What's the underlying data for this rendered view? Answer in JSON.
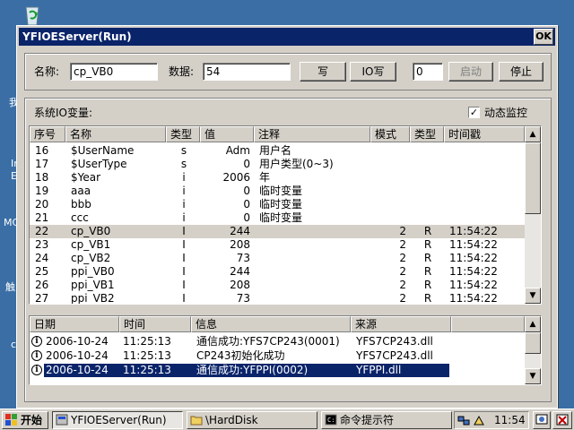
{
  "window": {
    "title": "YFIOEServer(Run)",
    "ok_label": "OK"
  },
  "controls": {
    "name_label": "名称:",
    "name_value": "cp_VB0",
    "data_label": "数据:",
    "data_value": "54",
    "write_label": "写",
    "io_write_label": "IO写",
    "counter_value": "0",
    "start_label": "启动",
    "stop_label": "停止"
  },
  "vars": {
    "section_label": "系统IO变量:",
    "monitor_label": "动态监控",
    "monitor_checked": true,
    "columns": [
      "序号",
      "名称",
      "类型",
      "值",
      "注释",
      "模式",
      "类型",
      "时间戳"
    ],
    "rows": [
      [
        "16",
        "$UserName",
        "s",
        "Adm",
        "用户名",
        "",
        "",
        ""
      ],
      [
        "17",
        "$UserType",
        "s",
        "0",
        "用户类型(0~3)",
        "",
        "",
        ""
      ],
      [
        "18",
        "$Year",
        "i",
        "2006",
        "年",
        "",
        "",
        ""
      ],
      [
        "19",
        "aaa",
        "i",
        "0",
        "临时变量",
        "",
        "",
        ""
      ],
      [
        "20",
        "bbb",
        "i",
        "0",
        "临时变量",
        "",
        "",
        ""
      ],
      [
        "21",
        "ccc",
        "i",
        "0",
        "临时变量",
        "",
        "",
        ""
      ],
      [
        "22",
        "cp_VB0",
        "I",
        "244",
        "",
        "2",
        "R",
        "11:54:22"
      ],
      [
        "23",
        "cp_VB1",
        "I",
        "208",
        "",
        "2",
        "R",
        "11:54:22"
      ],
      [
        "24",
        "cp_VB2",
        "I",
        "73",
        "",
        "2",
        "R",
        "11:54:22"
      ],
      [
        "25",
        "ppi_VB0",
        "I",
        "244",
        "",
        "2",
        "R",
        "11:54:22"
      ],
      [
        "26",
        "ppi_VB1",
        "I",
        "208",
        "",
        "2",
        "R",
        "11:54:22"
      ],
      [
        "27",
        "ppi_VB2",
        "I",
        "73",
        "",
        "2",
        "R",
        "11:54:22"
      ]
    ],
    "selected_row": 6
  },
  "log": {
    "columns": [
      "日期",
      "时间",
      "信息",
      "来源"
    ],
    "rows": [
      [
        "2006-10-24",
        "11:25:13",
        "通信成功:YFS7CP243(0001)",
        "YFS7CP243.dll"
      ],
      [
        "2006-10-24",
        "11:25:13",
        "CP243初始化成功",
        "YFS7CP243.dll"
      ],
      [
        "2006-10-24",
        "11:25:13",
        "通信成功:YFPPI(0002)",
        "YFPPI.dll"
      ]
    ],
    "selected_row": 2
  },
  "taskbar": {
    "start_label": "开始",
    "tasks": [
      "YFIOEServer(Run)",
      "\\HardDisk",
      "命令提示符"
    ],
    "clock": "11:54"
  },
  "desktop": {
    "edge_labels": [
      "我",
      "Ir",
      "E",
      "MC",
      "触",
      "c"
    ]
  },
  "colors": {
    "titlebar": "#0a246a",
    "selection": "#0a246a",
    "highlight_row": "#d4d0c8",
    "desktop": "#3a6ea5"
  }
}
